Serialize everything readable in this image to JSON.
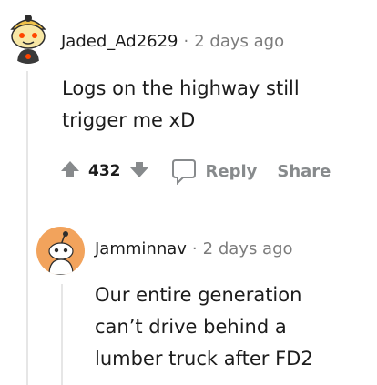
{
  "comment": {
    "username": "Jaded_Ad2629",
    "separator": "·",
    "time": "2 days ago",
    "body_line1": "Logs on the highway still",
    "body_line2": "trigger me xD",
    "score": "432",
    "reply_label": "Reply",
    "share_label": "Share"
  },
  "reply": {
    "username": "Jamminnav",
    "separator": "·",
    "time": "2 days ago",
    "body_line1": "Our entire generation",
    "body_line2": "can’t drive behind a",
    "body_line3": "lumber truck after FD2"
  },
  "colors": {
    "upvote": "#878a8c",
    "meta_text": "#7c7c7c",
    "reply_avatar_bg": "#f2a35c",
    "thread_line": "#e6e6e6"
  },
  "icons": [
    "upvote-icon",
    "downvote-icon",
    "comment-bubble-icon",
    "snoo-avatar-icon"
  ]
}
